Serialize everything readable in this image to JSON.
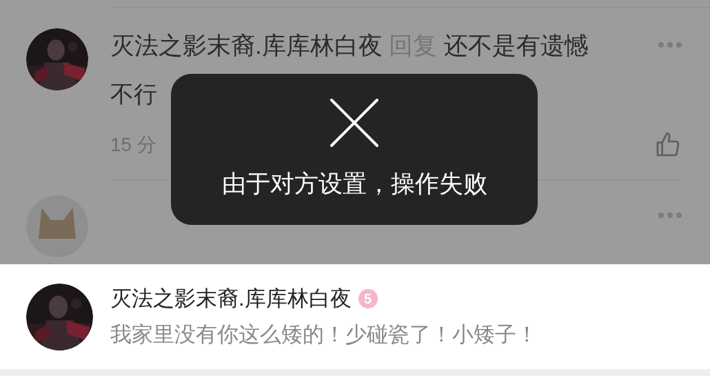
{
  "comments": [
    {
      "author": "灭法之影末裔.库库林白夜",
      "reply_label": "回复",
      "reply_to": "还不是有遗憾",
      "content": "不行",
      "time": "15 分",
      "liked": false
    }
  ],
  "toast": {
    "message": "由于对方设置，操作失败"
  },
  "preview": {
    "author": "灭法之影末裔.库库林白夜",
    "level_badge": "5",
    "message": "我家里没有你这么矮的！少碰瓷了！小矮子！"
  }
}
